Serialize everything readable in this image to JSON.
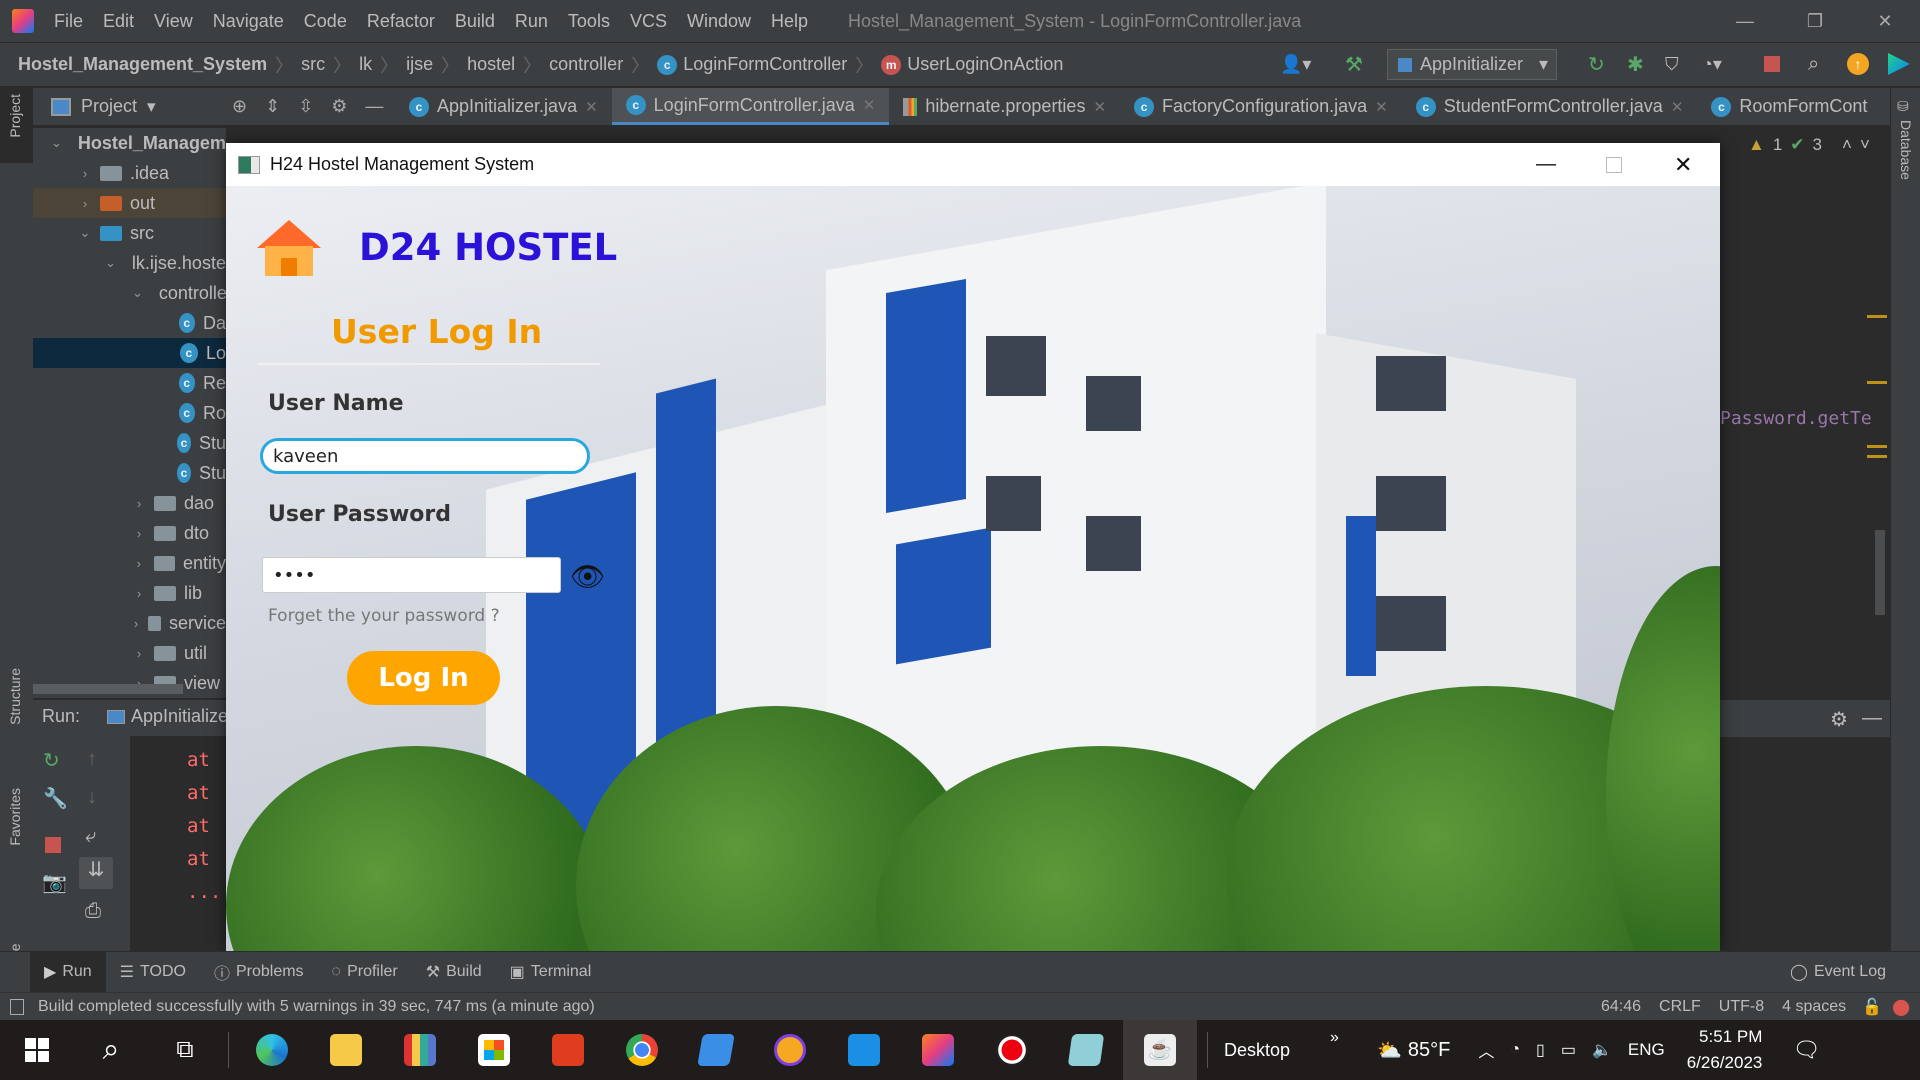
{
  "menu": {
    "items": [
      "File",
      "Edit",
      "View",
      "Navigate",
      "Code",
      "Refactor",
      "Build",
      "Run",
      "Tools",
      "VCS",
      "Window",
      "Help"
    ],
    "title": "Hostel_Management_System - LoginFormController.java"
  },
  "breadcrumb": {
    "items": [
      "Hostel_Management_System",
      "src",
      "lk",
      "ijse",
      "hostel",
      "controller",
      "LoginFormController",
      "UserLoginOnAction"
    ]
  },
  "toolbar": {
    "run_config": "AppInitializer"
  },
  "project_panel": {
    "title": "Project"
  },
  "tabs": [
    {
      "label": "AppInitializer.java"
    },
    {
      "label": "LoginFormController.java",
      "active": true
    },
    {
      "label": "hibernate.properties"
    },
    {
      "label": "FactoryConfiguration.java"
    },
    {
      "label": "StudentFormController.java"
    },
    {
      "label": "RoomFormCont"
    }
  ],
  "tree": [
    {
      "label": "Hostel_Management_System",
      "type": "module",
      "depth": 0,
      "open": true
    },
    {
      "label": ".idea",
      "type": "folder",
      "depth": 1
    },
    {
      "label": "out",
      "type": "folder-out",
      "depth": 1
    },
    {
      "label": "src",
      "type": "folder-src",
      "depth": 1,
      "open": true
    },
    {
      "label": "lk.ijse.hostel",
      "type": "package",
      "depth": 2,
      "open": true
    },
    {
      "label": "controller",
      "type": "package",
      "depth": 3,
      "open": true
    },
    {
      "label": "Da",
      "type": "class",
      "depth": 4
    },
    {
      "label": "Lo",
      "type": "class",
      "depth": 4,
      "selected": true
    },
    {
      "label": "Re",
      "type": "class",
      "depth": 4
    },
    {
      "label": "Ro",
      "type": "class",
      "depth": 4
    },
    {
      "label": "Stu",
      "type": "class",
      "depth": 4
    },
    {
      "label": "Stu",
      "type": "class",
      "depth": 4
    },
    {
      "label": "dao",
      "type": "package",
      "depth": 3
    },
    {
      "label": "dto",
      "type": "package",
      "depth": 3
    },
    {
      "label": "entity",
      "type": "package",
      "depth": 3
    },
    {
      "label": "lib",
      "type": "package",
      "depth": 3
    },
    {
      "label": "service",
      "type": "package",
      "depth": 3
    },
    {
      "label": "util",
      "type": "package",
      "depth": 3
    },
    {
      "label": "view",
      "type": "package",
      "depth": 3
    }
  ],
  "left_strip": {
    "project": "Project",
    "structure": "Structure",
    "favorites": "Favorites",
    "jpa": "JPA Structure"
  },
  "right_strip": {
    "database": "Database"
  },
  "inspections": {
    "warnings": "1",
    "ok": "3",
    "weak": "3"
  },
  "editor": {
    "code_fragment": "Password.getTe"
  },
  "run": {
    "label": "Run:",
    "config": "AppInitializer",
    "lines": [
      "at",
      "at",
      "at",
      "at",
      "..."
    ]
  },
  "bottom_tools": [
    "Run",
    "TODO",
    "Problems",
    "Profiler",
    "Build",
    "Terminal"
  ],
  "event_log": "Event Log",
  "status": {
    "message": "Build completed successfully with 5 warnings in 39 sec, 747 ms (a minute ago)",
    "position": "64:46",
    "line_sep": "CRLF",
    "encoding": "UTF-8",
    "indent": "4 spaces"
  },
  "dialog": {
    "title": "H24 Hostel Management System",
    "brand": "D24 HOSTEL",
    "heading": "User Log In",
    "username_label": "User Name",
    "username_value": "kaveen",
    "password_label": "User Password",
    "password_value": "kave",
    "forgot": "Forget the your password ?",
    "login_button": "Log In",
    "colors": {
      "brand": "#2a12d8",
      "heading": "#f09a00",
      "button": "#ffa500",
      "focus": "#29a8e0"
    }
  },
  "taskbar": {
    "desktop": "Desktop",
    "weather": "85°F",
    "lang": "ENG",
    "time": "5:51 PM",
    "date": "6/26/2023"
  }
}
